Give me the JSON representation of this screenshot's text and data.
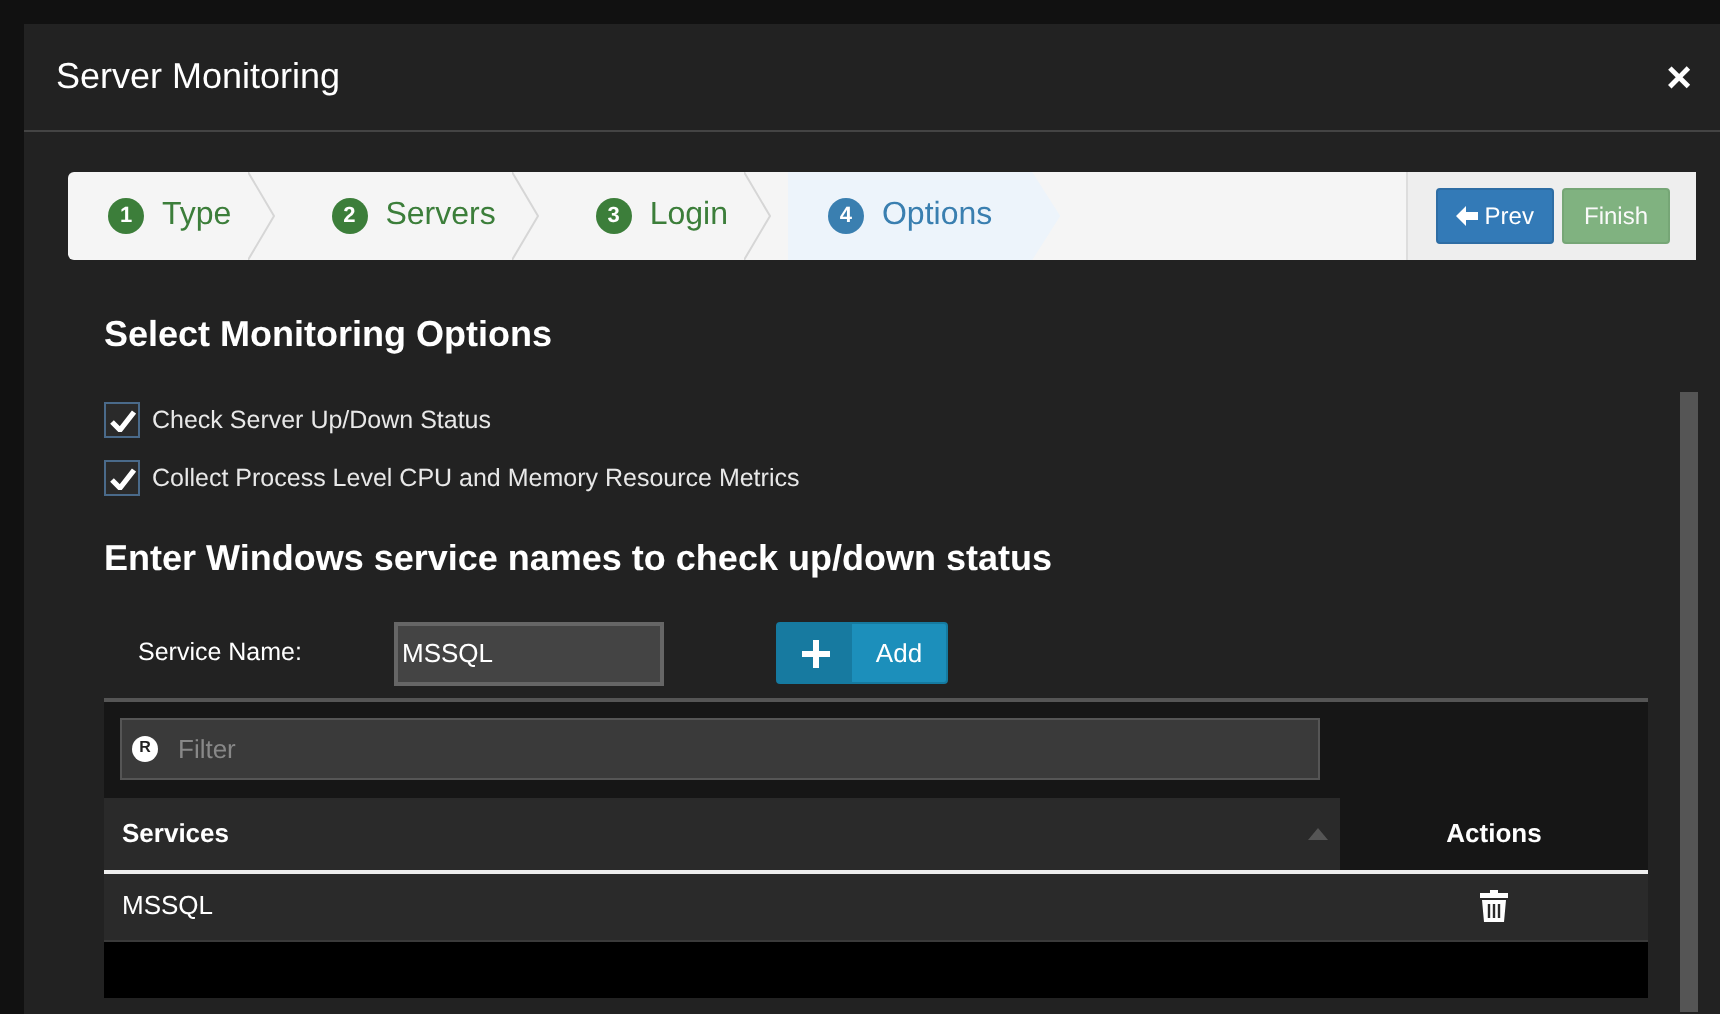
{
  "dialog": {
    "title": "Server Monitoring",
    "close": "×"
  },
  "wizard": {
    "steps": [
      {
        "number": "1",
        "label": "Type",
        "selected": false
      },
      {
        "number": "2",
        "label": "Servers",
        "selected": false
      },
      {
        "number": "3",
        "label": "Login",
        "selected": false
      },
      {
        "number": "4",
        "label": "Options",
        "selected": true
      }
    ],
    "buttons": [
      {
        "kind": "prev",
        "label": "Prev",
        "disabled": false
      },
      {
        "kind": "finish",
        "label": "Finish",
        "disabled": true
      }
    ]
  },
  "options": {
    "heading": "Select Monitoring Options",
    "checkboxes": [
      {
        "label": "Check Server Up/Down Status",
        "checked": true
      },
      {
        "label": "Collect Process Level CPU and Memory Resource Metrics",
        "checked": true
      }
    ]
  },
  "services": {
    "heading": "Enter Windows service names to check up/down status",
    "field_label": "Service Name:",
    "value": "MSSQL",
    "add_button": "Add"
  },
  "table": {
    "filter_badge": "R",
    "filter_placeholder": "Filter",
    "columns": [
      "Services",
      "Actions"
    ],
    "rows": [
      {
        "service": "MSSQL"
      }
    ]
  }
}
